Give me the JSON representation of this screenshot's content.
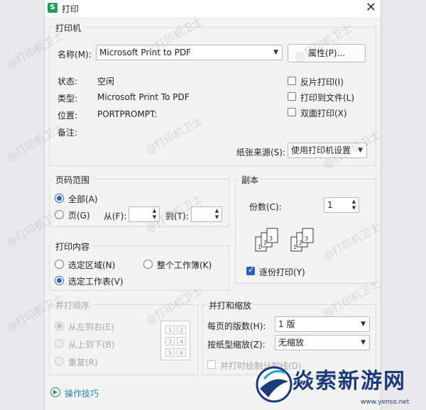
{
  "window": {
    "app_icon_letter": "S",
    "title": "打印"
  },
  "printer": {
    "group_label": "打印机",
    "name_label": "名称",
    "name_key": "(M):",
    "name_value": "Microsoft Print to PDF",
    "properties_button": "属性(P)...",
    "status_label": "状态:",
    "status_value": "空闲",
    "type_label": "类型:",
    "type_value": "Microsoft Print To PDF",
    "location_label": "位置:",
    "location_value": "PORTPROMPT:",
    "comment_label": "备注:",
    "reverse_print": "反片打印(I)",
    "print_to_file": "打印到文件(L)",
    "duplex_print": "双面打印(X)",
    "paper_source_label": "纸张来源(S):",
    "paper_source_value": "使用打印机设置"
  },
  "page_range": {
    "group_label": "页码范围",
    "all": "全部(A)",
    "pages": "页(G)",
    "from_label": "从(F):",
    "to_label": "到(T):"
  },
  "copies": {
    "group_label": "副本",
    "count_label": "份数(C):",
    "count_value": "1",
    "collate": "逐份打印(Y)"
  },
  "print_content": {
    "group_label": "打印内容",
    "selection": "选定区域(N)",
    "workbook": "整个工作簿(K)",
    "sheet": "选定工作表(V)"
  },
  "print_order": {
    "group_label": "并打顺序",
    "left_to_right": "从左到右(E)",
    "top_to_bottom": "从上到下(B)",
    "repeat": "重复(R)",
    "order_numbers": [
      "1",
      "2",
      "3",
      "4",
      "5",
      "6"
    ]
  },
  "zoom": {
    "group_label": "并打和缩放",
    "pages_per_sheet_label": "每页的版数(H):",
    "pages_per_sheet_value": "1 版",
    "scale_label": "按纸型缩放(Z):",
    "scale_value": "无缩放",
    "split_lines": "并打时绘制分割线(D)"
  },
  "footer": {
    "tips_link": "操作技巧"
  },
  "watermark_text": "@打印机卫士",
  "brand": {
    "name": "焱索新游网",
    "url": "www.yenso.net"
  }
}
